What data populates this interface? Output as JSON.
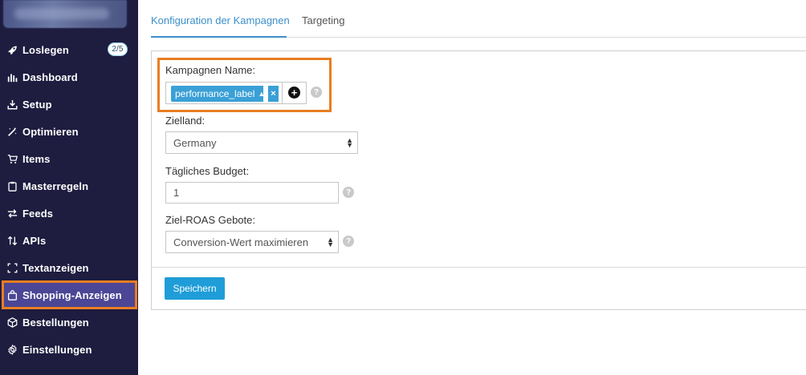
{
  "sidebar": {
    "items": [
      {
        "label": "Loslegen",
        "icon": "rocket-icon",
        "badge": "2/5"
      },
      {
        "label": "Dashboard",
        "icon": "bar-chart-icon"
      },
      {
        "label": "Setup",
        "icon": "download-tray-icon"
      },
      {
        "label": "Optimieren",
        "icon": "magic-wand-icon"
      },
      {
        "label": "Items",
        "icon": "cart-icon"
      },
      {
        "label": "Masterregeln",
        "icon": "clipboard-icon"
      },
      {
        "label": "Feeds",
        "icon": "transfer-arrows-icon"
      },
      {
        "label": "APIs",
        "icon": "up-down-arrows-icon"
      },
      {
        "label": "Textanzeigen",
        "icon": "frame-corners-icon"
      },
      {
        "label": "Shopping-Anzeigen",
        "icon": "shopping-bag-icon",
        "active": true
      },
      {
        "label": "Bestellungen",
        "icon": "box-icon"
      },
      {
        "label": "Einstellungen",
        "icon": "gear-icon"
      }
    ]
  },
  "tabs": [
    {
      "label": "Konfiguration der Kampagnen",
      "active": true
    },
    {
      "label": "Targeting",
      "active": false
    }
  ],
  "form": {
    "campaign_name": {
      "label": "Kampagnen Name:",
      "tag": "performance_label",
      "remove": "×",
      "add": "+",
      "help": "?"
    },
    "target_country": {
      "label": "Zielland:",
      "value": "Germany"
    },
    "daily_budget": {
      "label": "Tägliches Budget:",
      "value": "1",
      "help": "?"
    },
    "roas": {
      "label": "Ziel-ROAS Gebote:",
      "value": "Conversion-Wert maximieren",
      "help": "?"
    },
    "save_label": "Speichern"
  },
  "colors": {
    "sidebar_bg": "#1e1c3f",
    "active_item_bg": "#4b4695",
    "highlight": "#e97d22",
    "accent": "#3b8fc9",
    "button": "#1f9dd8"
  }
}
